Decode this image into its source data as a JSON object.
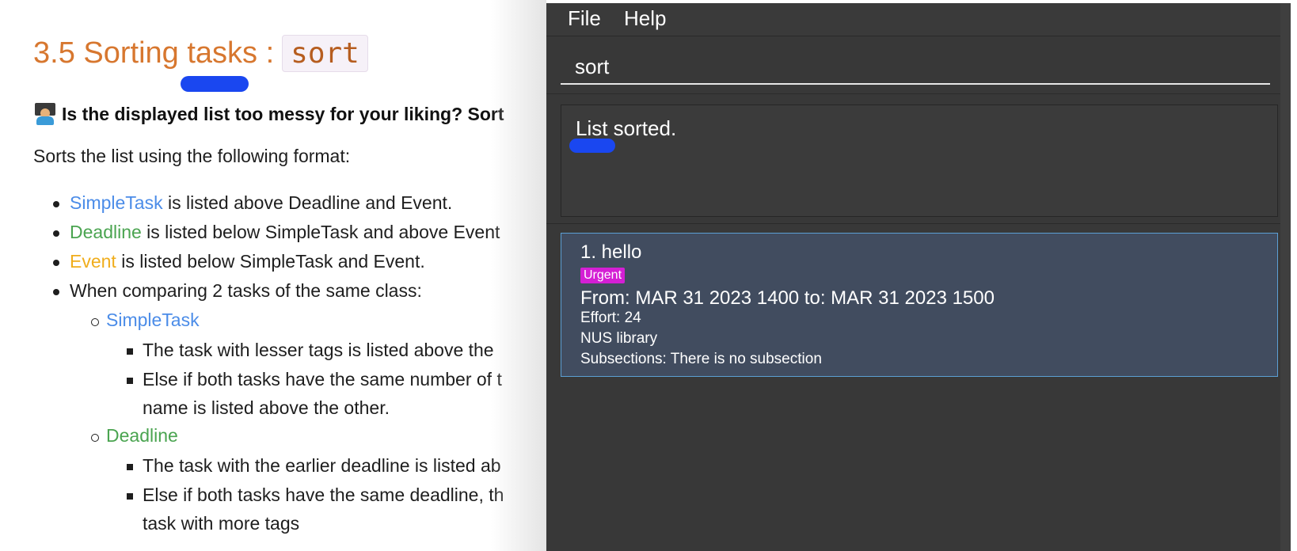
{
  "doc": {
    "heading": "3.5 Sorting tasks :",
    "heading_code": "sort",
    "lead": "Is the displayed list too messy for your liking? Sort",
    "intro": "Sorts the list using the following format:",
    "bullets": {
      "b1_link": "SimpleTask",
      "b1_rest": " is listed above Deadline and Event.",
      "b2_link": "Deadline",
      "b2_rest": " is listed below SimpleTask and above Event",
      "b3_link": "Event",
      "b3_rest": " is listed below SimpleTask and Event.",
      "b4": "When comparing 2 tasks of the same class:",
      "sub1": "SimpleTask",
      "sub1_a": "The task with lesser tags is listed above the",
      "sub1_b": "Else if both tasks have the same number of t",
      "sub1_b2": "name is listed above the other.",
      "sub2": "Deadline",
      "sub2_a": "The task with the earlier deadline is listed ab",
      "sub2_b": "Else if both tasks have the same deadline, th",
      "sub2_b2": "task with more tags"
    },
    "colors": {
      "heading": "#d7772f",
      "simpletask": "#4b8ce8",
      "deadline": "#4aa450",
      "event": "#f0ad1c",
      "highlight_mark": "#1a47f0"
    }
  },
  "app": {
    "menu": {
      "file": "File",
      "help": "Help"
    },
    "command_value": "sort",
    "result": "List sorted.",
    "task": {
      "title": "1.  hello",
      "tag": "Urgent",
      "time": "From: MAR 31 2023 1400 to: MAR 31 2023 1500",
      "effort": "Effort: 24",
      "location": "NUS library",
      "subsections": "Subsections: There is no subsection"
    },
    "colors": {
      "background": "#383838",
      "card": "#414c5f",
      "card_border": "#5b9fd4",
      "tag": "#d41fd4"
    }
  }
}
